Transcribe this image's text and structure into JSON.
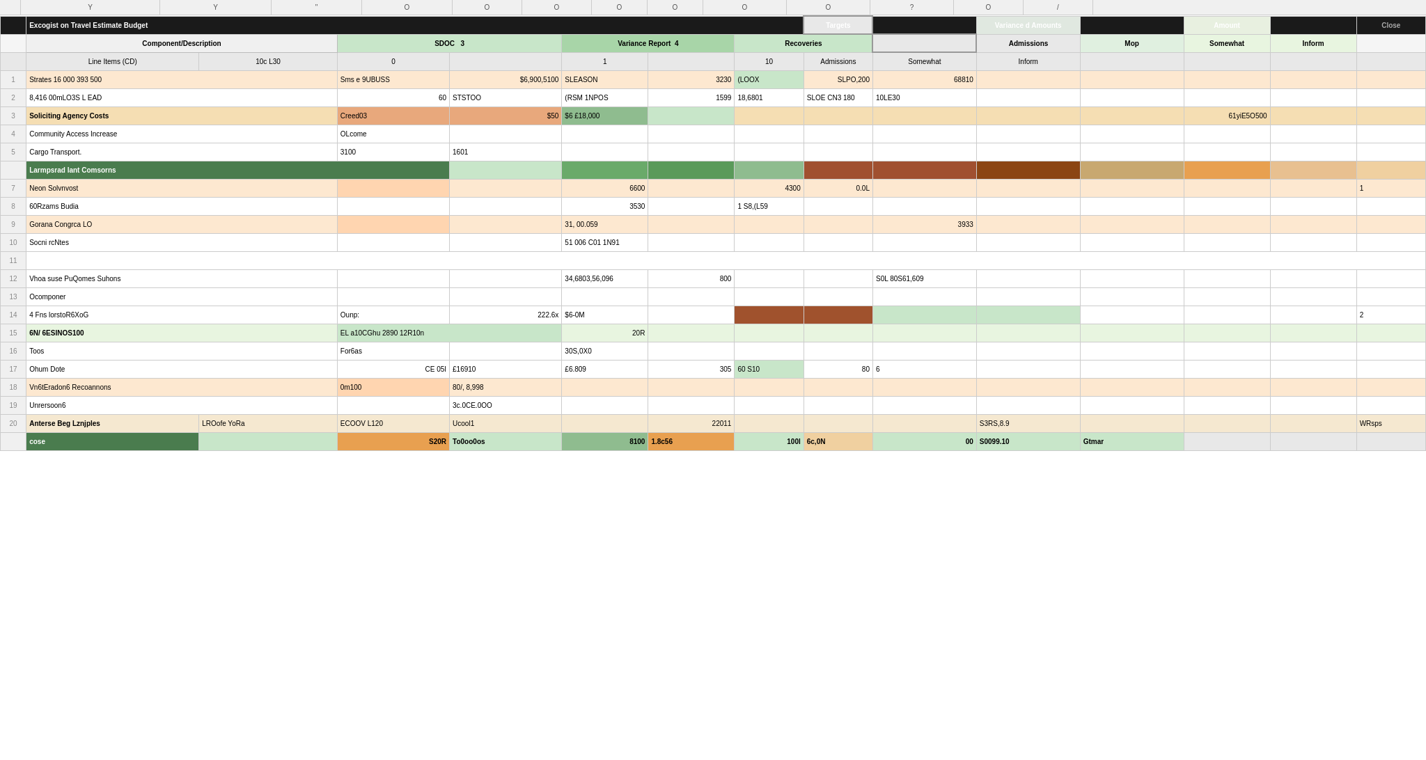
{
  "title": "Excogist on Travel Estimate Budget",
  "columns": {
    "ruler": [
      "",
      "Y",
      "Y",
      "\"",
      "O",
      "O",
      "O",
      "O",
      "O",
      "O",
      "O",
      "?",
      "O",
      "/"
    ]
  },
  "headers": {
    "row1": [
      "Component/Description",
      "SDOC",
      "",
      "Variance Report",
      "",
      "Recoveries",
      "",
      "Targets",
      "",
      "Variance d Amounts",
      "",
      "Amount",
      "",
      "Close"
    ],
    "row2": [
      "",
      "",
      "3",
      "",
      "4",
      "",
      "",
      "",
      "",
      "",
      "",
      "Mop",
      "",
      ""
    ],
    "subrow": [
      "Line Items (CD)",
      "10c L30",
      "0",
      "",
      "1",
      "",
      "10",
      "Admissions",
      "Somewhat",
      "Inform"
    ]
  },
  "rows": [
    {
      "id": 1,
      "type": "data",
      "style": "peach",
      "cells": [
        "Strates 16 000 393 500",
        "Sms e 9UBUSS",
        "$6,900,5100",
        "SLEASON",
        "3230",
        "(LOOX",
        "SLPO,200",
        "68810",
        ""
      ]
    },
    {
      "id": 2,
      "type": "data",
      "style": "normal",
      "cells": [
        "8,416 00mLO3S L EAD",
        "60",
        "STSTOO",
        "(RSM 1NPOS",
        "1599",
        "18,6801",
        "SLOE CN3  180",
        "10LE30",
        ""
      ]
    },
    {
      "id": 3,
      "type": "section",
      "style": "orange",
      "cells": [
        "Soliciting Agency Costs",
        "Creedo3",
        "$50",
        "$6 £18,000",
        "",
        "",
        "",
        "61yiE5O500",
        ""
      ]
    },
    {
      "id": 4,
      "type": "data",
      "style": "normal",
      "cells": [
        "Community Access Increase",
        "OLcome",
        "",
        "",
        "",
        "",
        "",
        "",
        ""
      ]
    },
    {
      "id": 5,
      "type": "data",
      "style": "normal",
      "cells": [
        "Cargo Transport.",
        "3100",
        "1601",
        "",
        "",
        "",
        "",
        "",
        ""
      ]
    },
    {
      "id": 6,
      "type": "cat-header",
      "style": "green-header",
      "cells": [
        "Larmpsrad lant Comsorns",
        "",
        "",
        "",
        "",
        "",
        "",
        "",
        ""
      ]
    },
    {
      "id": 7,
      "type": "data",
      "style": "peach",
      "cells": [
        "Neon Solvnvost",
        "",
        "",
        "6600",
        "",
        "4300",
        "0.0L",
        "",
        "1"
      ]
    },
    {
      "id": 8,
      "type": "data",
      "style": "normal",
      "cells": [
        "60Rzams Budia",
        "",
        "",
        "3530",
        "",
        "1 S8,(L59",
        "",
        "",
        ""
      ]
    },
    {
      "id": 9,
      "type": "data",
      "style": "peach",
      "cells": [
        "Gorana Congrca LO",
        "",
        "",
        "31, 00.059",
        "",
        "",
        "3933",
        "",
        ""
      ]
    },
    {
      "id": 10,
      "type": "data",
      "style": "normal",
      "cells": [
        "Socni rcNtes",
        "",
        "",
        "51 006 C01 1N91",
        "",
        "",
        "",
        "",
        ""
      ]
    },
    {
      "id": 11,
      "type": "empty",
      "style": "normal",
      "cells": [
        "",
        "",
        "",
        "",
        "",
        "",
        "",
        "",
        ""
      ]
    },
    {
      "id": 12,
      "type": "data",
      "style": "normal",
      "cells": [
        "Vhoa suse PuQomes Suhons",
        "",
        "",
        "34,6803,56,096",
        "800",
        "",
        "S0L 80S61,609",
        "",
        ""
      ]
    },
    {
      "id": 13,
      "type": "data",
      "style": "normal",
      "cells": [
        "Ocomponer",
        "",
        "",
        "",
        "",
        "",
        "",
        "",
        ""
      ]
    },
    {
      "id": 14,
      "type": "data",
      "style": "brown-accent",
      "cells": [
        "4 Fns lorstoR6XoG",
        "Ounp:",
        "222.6x",
        "$6-0M",
        "",
        "",
        "",
        "",
        "2"
      ]
    },
    {
      "id": 15,
      "type": "section",
      "style": "green-section",
      "cells": [
        "6N/ 6ESINOS100",
        "EL a10CGhu 2890 12R10n",
        "",
        "20R",
        "",
        "",
        "",
        "",
        ""
      ]
    },
    {
      "id": 16,
      "type": "data",
      "style": "normal",
      "cells": [
        "Toos",
        "For6as",
        "",
        "30S,0X0",
        "",
        "",
        "",
        "",
        ""
      ]
    },
    {
      "id": 17,
      "type": "data",
      "style": "normal",
      "cells": [
        "Ohum Dote",
        "",
        "CE 05I",
        "£16910",
        "£6.809",
        "305",
        "60 S10",
        "80",
        "6"
      ]
    },
    {
      "id": 18,
      "type": "data",
      "style": "peach",
      "cells": [
        "Vn6tEradon6 Recoannons",
        "",
        "0m100",
        "80/, 8,998",
        "",
        "",
        "",
        "",
        ""
      ]
    },
    {
      "id": 19,
      "type": "data",
      "style": "normal",
      "cells": [
        "Unrersoon6",
        "",
        "3c.0CE.0OO",
        "",
        "",
        "",
        "",
        "",
        ""
      ]
    },
    {
      "id": 20,
      "type": "data",
      "style": "summary",
      "cells": [
        "Anterse Beg Lznjples",
        "LROofe YoRa",
        "ECOOV L120",
        "Ucool1",
        "",
        "22011",
        "",
        "S3RS,8.9",
        "WRsps"
      ]
    },
    {
      "id": 21,
      "type": "totals",
      "style": "totals",
      "cells": [
        "cose",
        "",
        "S20R",
        "To0oo0os",
        "8100",
        "1.8c56",
        "100l",
        "6c,0N",
        "00",
        "S0099.10",
        "Gtmar"
      ]
    }
  ]
}
